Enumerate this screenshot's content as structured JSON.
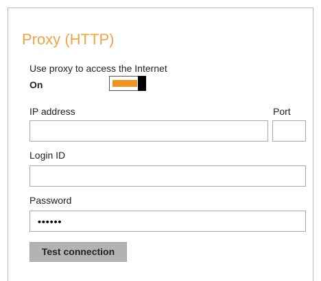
{
  "section": {
    "title": "Proxy (HTTP)",
    "accent_color": "#f0a441"
  },
  "proxy_toggle": {
    "label": "Use proxy to access the Internet",
    "state_label": "On",
    "enabled": true,
    "on_color": "#f39121"
  },
  "ip_address": {
    "label": "IP address",
    "value": ""
  },
  "port": {
    "label": "Port",
    "value": ""
  },
  "login_id": {
    "label": "Login ID",
    "value": ""
  },
  "password": {
    "label": "Password",
    "masked_value": "••••••"
  },
  "test_button": {
    "label": "Test connection"
  }
}
